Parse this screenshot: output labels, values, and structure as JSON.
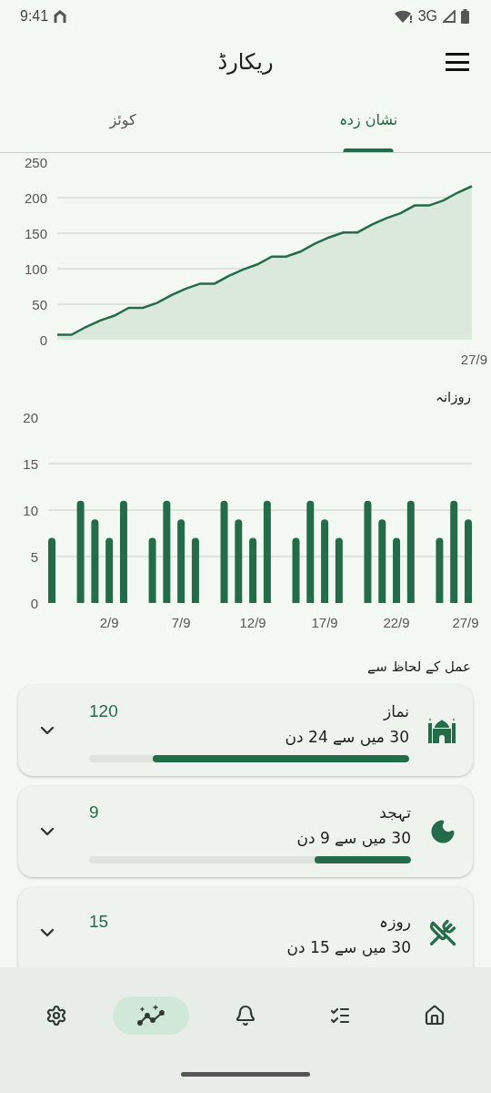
{
  "status_bar": {
    "time": "9:41",
    "network": "3G"
  },
  "header": {
    "title": "ریکارڈ"
  },
  "tabs": [
    {
      "label": "نشان زدہ",
      "selected": true
    },
    {
      "label": "کوئز",
      "selected": false
    }
  ],
  "cumulative_chart": {
    "chart_data": {
      "type": "area",
      "categories": [
        null,
        null,
        null,
        null,
        null,
        null,
        null,
        null,
        null,
        null,
        null,
        null,
        null,
        null,
        null,
        null,
        null,
        null,
        null,
        null,
        null,
        null,
        null,
        null,
        null,
        null,
        null,
        null,
        null,
        "27/9"
      ],
      "series": [
        {
          "color": "#246b4a",
          "values": [
            7,
            7,
            18,
            27,
            34,
            45,
            45,
            52,
            63,
            72,
            79,
            79,
            90,
            99,
            106,
            117,
            117,
            124,
            135,
            144,
            151,
            151,
            162,
            171,
            178,
            189,
            189,
            196,
            207,
            216
          ]
        }
      ],
      "ylim": [
        0,
        250
      ],
      "yticks": [
        0,
        50,
        100,
        150,
        200,
        250
      ],
      "grid": true
    }
  },
  "daily_chart": {
    "chart_data": {
      "type": "bar",
      "title": "روزانہ",
      "categories": [
        null,
        null,
        null,
        null,
        "2/9",
        null,
        null,
        null,
        null,
        "7/9",
        null,
        null,
        null,
        null,
        "12/9",
        null,
        null,
        null,
        null,
        "17/9",
        null,
        null,
        null,
        null,
        "22/9",
        null,
        null,
        null,
        null,
        "27/9"
      ],
      "series": [
        {
          "color": "#246b4a",
          "values": [
            7,
            0,
            11,
            9,
            7,
            11,
            0,
            7,
            11,
            9,
            7,
            0,
            11,
            9,
            7,
            11,
            0,
            7,
            11,
            9,
            7,
            0,
            11,
            9,
            7,
            11,
            0,
            7,
            11,
            9
          ]
        }
      ],
      "ylim": [
        0,
        20
      ],
      "yticks": [
        0,
        5,
        10,
        15,
        20
      ],
      "grid": true
    }
  },
  "by_deed": {
    "title": "عمل کے لحاظ سے",
    "items": [
      {
        "kind": "prayer",
        "name": "نماز",
        "count": "120",
        "summary": "30 میں سے 24 دن",
        "level": 0.8
      },
      {
        "kind": "night",
        "name": "تہجد",
        "count": "9",
        "summary": "30 میں سے 9 دن",
        "level": 0.3
      },
      {
        "kind": "fast",
        "name": "روزہ",
        "count": "15",
        "summary": "30 میں سے 15 دن"
      }
    ]
  },
  "nav": [
    {
      "selected": false
    },
    {
      "selected": false
    },
    {
      "selected": false
    },
    {
      "selected": true
    },
    {
      "selected": false
    }
  ]
}
